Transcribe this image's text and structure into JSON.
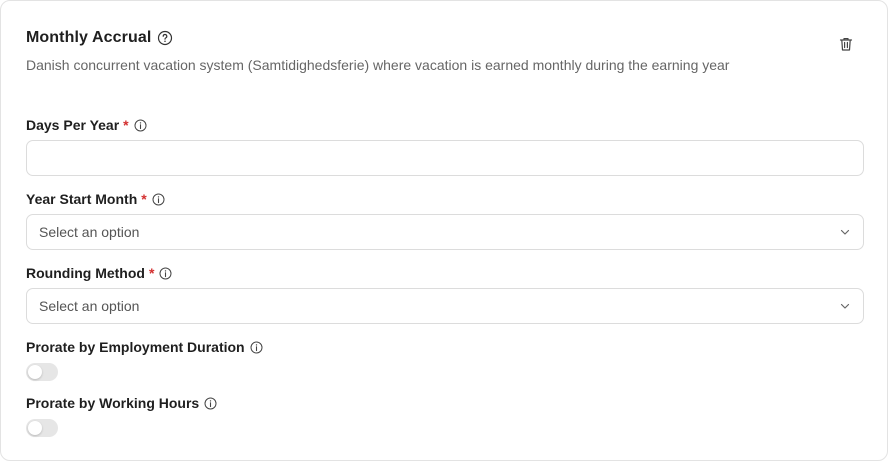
{
  "card": {
    "title": "Monthly Accrual",
    "subtitle": "Danish concurrent vacation system (Samtidighedsferie) where vacation is earned monthly during the earning year"
  },
  "fields": {
    "days_per_year": {
      "label": "Days Per Year",
      "required_mark": "*",
      "value": "",
      "placeholder": ""
    },
    "year_start_month": {
      "label": "Year Start Month",
      "required_mark": "*",
      "selected": "Select an option"
    },
    "rounding_method": {
      "label": "Rounding Method",
      "required_mark": "*",
      "selected": "Select an option"
    },
    "prorate_employment": {
      "label": "Prorate by Employment Duration",
      "enabled": false
    },
    "prorate_hours": {
      "label": "Prorate by Working Hours",
      "enabled": false
    }
  },
  "colors": {
    "required": "#d32f2f",
    "toggle_off": "#e6e6e6",
    "border": "#dcdcdc"
  },
  "icons": {
    "help": "question-circle-icon",
    "info": "info-circle-icon",
    "delete": "trash-icon",
    "select": "chevron-down-icon"
  }
}
